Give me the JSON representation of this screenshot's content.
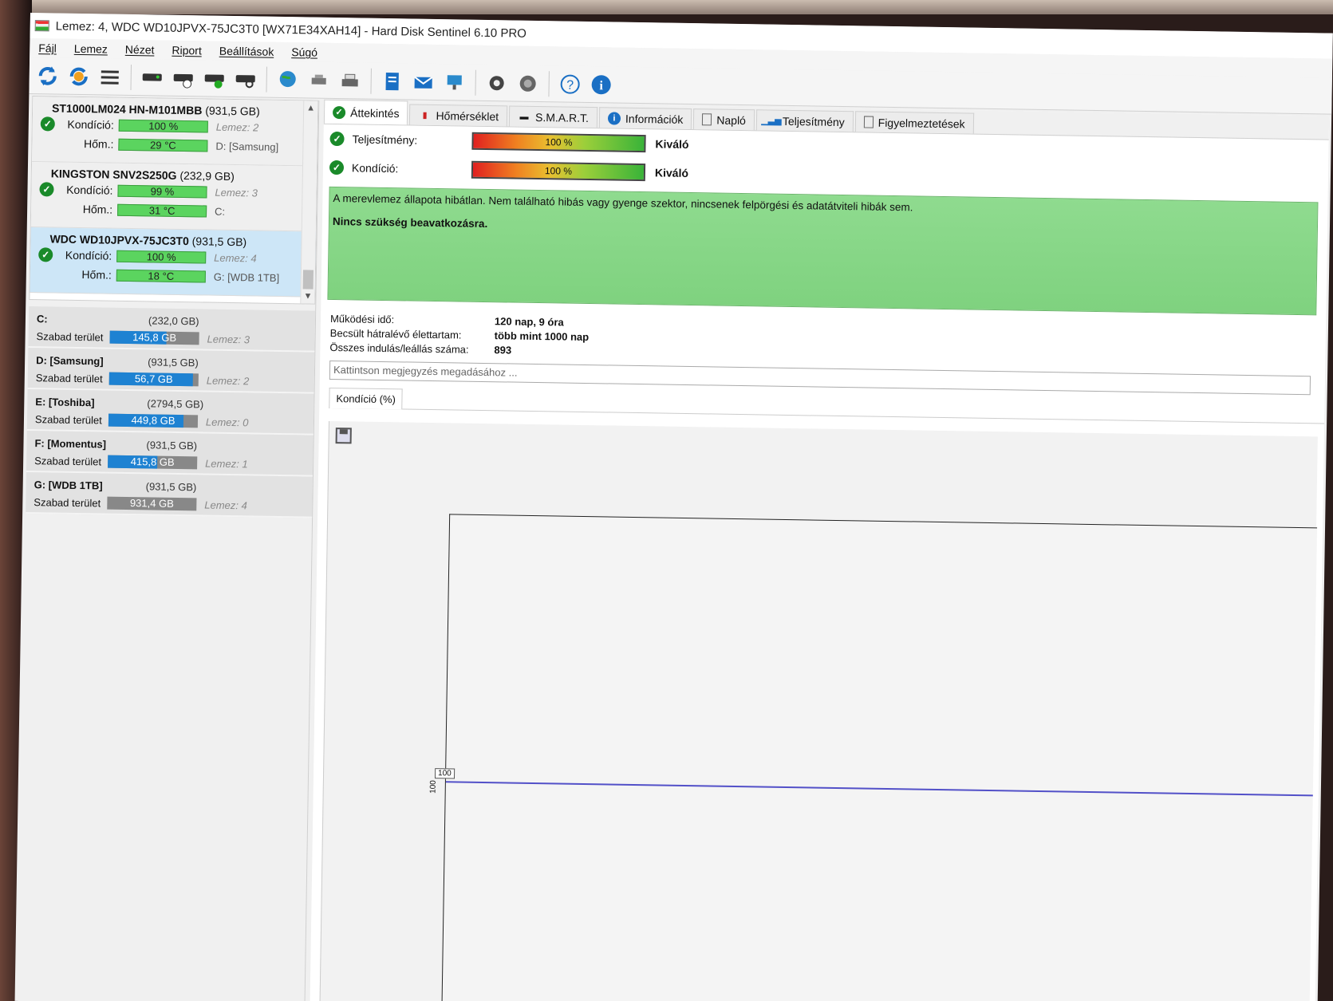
{
  "window": {
    "title": "Lemez: 4, WDC WD10JPVX-75JC3T0 [WX71E34XAH14]  -  Hard Disk Sentinel 6.10 PRO"
  },
  "menu": [
    "Fájl",
    "Lemez",
    "Nézet",
    "Riport",
    "Beállítások",
    "Súgó"
  ],
  "disks": [
    {
      "name": "ST1000LM024 HN-M101MBB",
      "size": "(931,5 GB)",
      "cond_label": "Kondíció:",
      "cond": "100 %",
      "cond_pct": 100,
      "temp_label": "Hőm.:",
      "temp": "29 °C",
      "disk_no": "Lemez: 2",
      "drive": "D: [Samsung]"
    },
    {
      "name": "KINGSTON SNV2S250G",
      "size": "(232,9 GB)",
      "cond_label": "Kondíció:",
      "cond": "99 %",
      "cond_pct": 99,
      "temp_label": "Hőm.:",
      "temp": "31 °C",
      "disk_no": "Lemez: 3",
      "drive": "C:"
    },
    {
      "name": "WDC WD10JPVX-75JC3T0",
      "size": "(931,5 GB)",
      "cond_label": "Kondíció:",
      "cond": "100 %",
      "cond_pct": 100,
      "temp_label": "Hőm.:",
      "temp": "18 °C",
      "disk_no": "Lemez: 4",
      "drive": "G: [WDB 1TB]"
    }
  ],
  "volumes": [
    {
      "name": "C:",
      "size": "(232,0 GB)",
      "free_label": "Szabad terület",
      "free": "145,8 GB",
      "disk": "Lemez: 3",
      "fill": 0.63
    },
    {
      "name": "D: [Samsung]",
      "size": "(931,5 GB)",
      "free_label": "Szabad terület",
      "free": "56,7 GB",
      "disk": "Lemez: 2",
      "fill": 0.94
    },
    {
      "name": "E: [Toshiba]",
      "size": "(2794,5 GB)",
      "free_label": "Szabad terület",
      "free": "449,8 GB",
      "disk": "Lemez: 0",
      "fill": 0.84
    },
    {
      "name": "F: [Momentus]",
      "size": "(931,5 GB)",
      "free_label": "Szabad terület",
      "free": "415,8 GB",
      "disk": "Lemez: 1",
      "fill": 0.55
    },
    {
      "name": "G: [WDB 1TB]",
      "size": "(931,5 GB)",
      "free_label": "Szabad terület",
      "free": "931,4 GB",
      "disk": "Lemez: 4",
      "fill": 0.0
    }
  ],
  "tabs": [
    "Áttekintés",
    "Hőmérséklet",
    "S.M.A.R.T.",
    "Információk",
    "Napló",
    "Teljesítmény",
    "Figyelmeztetések"
  ],
  "status": {
    "perf_label": "Teljesítmény:",
    "perf_value": "100 %",
    "perf_verdict": "Kiváló",
    "cond_label": "Kondíció:",
    "cond_value": "100 %",
    "cond_verdict": "Kiváló"
  },
  "description": {
    "line1": "A merevlemez állapota hibátlan. Nem található hibás vagy gyenge szektor, nincsenek felpörgési és adatátviteli hibák sem.",
    "line2": "Nincs szükség beavatkozásra."
  },
  "info": [
    {
      "k": "Működési idő:",
      "v": "120 nap, 9 óra"
    },
    {
      "k": "Becsült hátralévő élettartam:",
      "v": "több mint 1000 nap"
    },
    {
      "k": "Összes indulás/leállás száma:",
      "v": "893"
    }
  ],
  "note_placeholder": "Kattintson megjegyzés megadásához ...",
  "graph_tab": "Kondíció  (%)",
  "chart_data": {
    "type": "line",
    "series": [
      {
        "values": [
          100,
          100
        ]
      }
    ],
    "point_label": "100",
    "ytick": "100"
  },
  "colors": {
    "good": "#5bd45f",
    "free_space": "#1e82d2",
    "ok_panel": "#86d686",
    "graph_line": "#5250c8"
  }
}
